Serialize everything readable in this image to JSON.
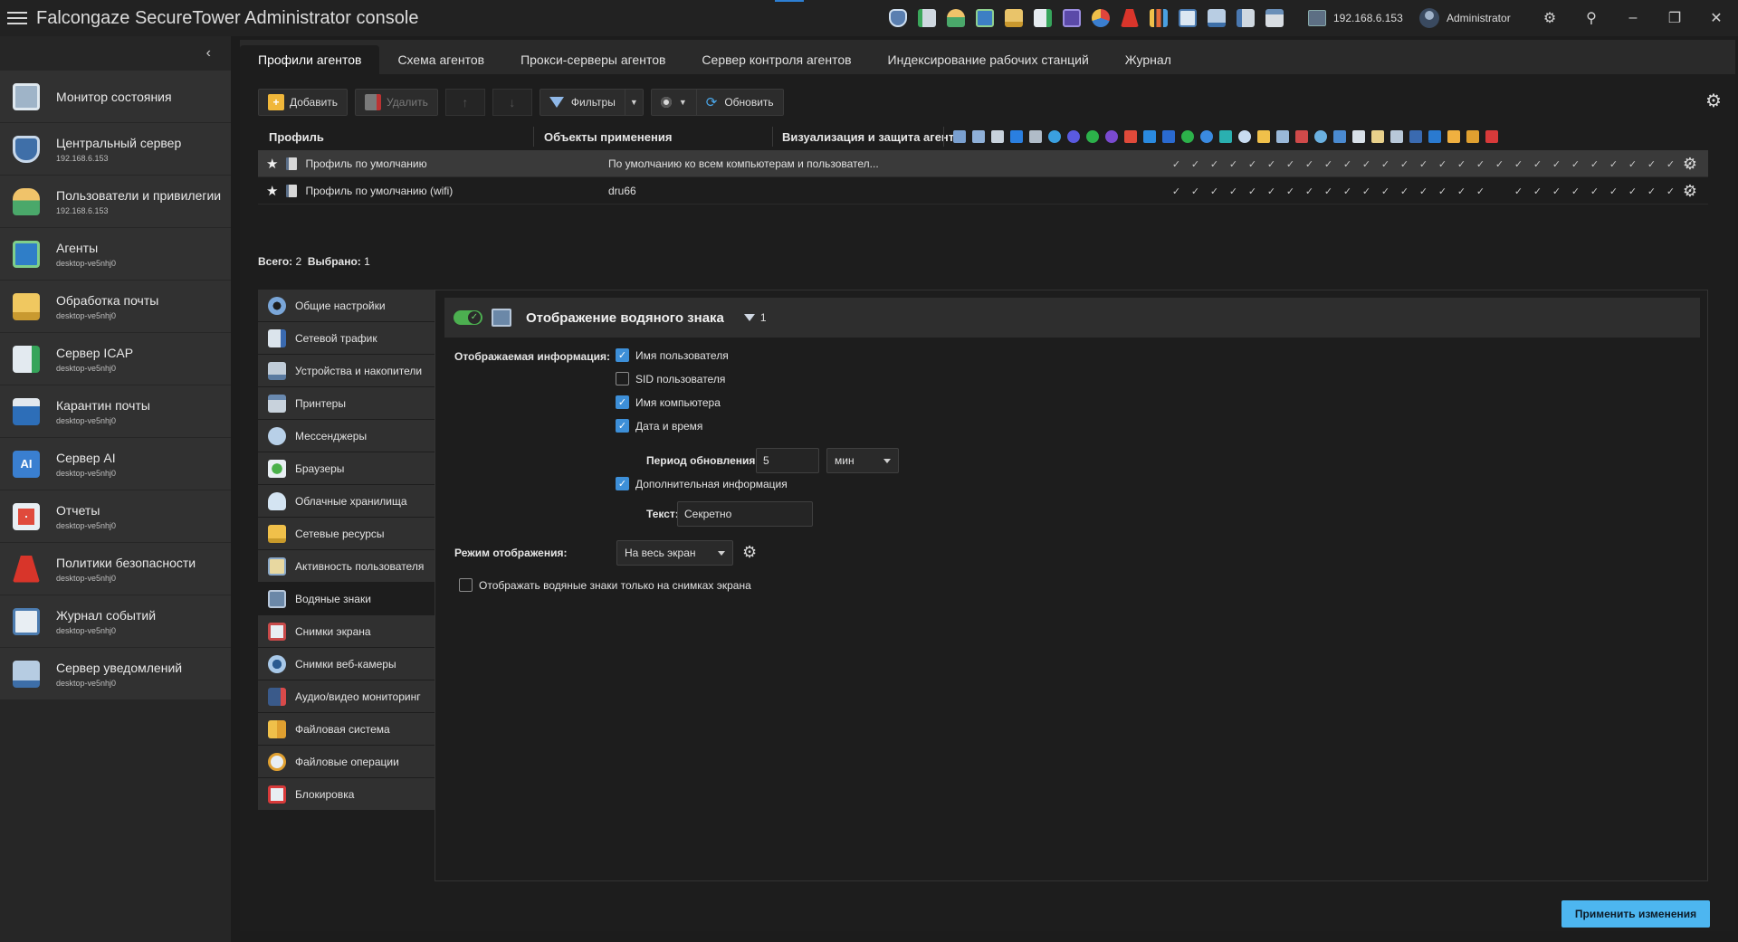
{
  "title_bar": {
    "app_name": "Falcongaze SecureTower",
    "app_subtitle": "Administrator console",
    "server_ip": "192.168.6.153",
    "user": "Administrator",
    "tray_icons": [
      "shield-icon",
      "server-icon",
      "users-icon",
      "agents-icon",
      "mail-icon",
      "icap-icon",
      "quarantine-icon",
      "reports-icon",
      "policies-icon",
      "stats-icon",
      "events-icon",
      "notify-icon",
      "network-icon",
      "printer-icon"
    ]
  },
  "left_nav": {
    "items": [
      {
        "label": "Монитор состояния",
        "sub": ""
      },
      {
        "label": "Центральный сервер",
        "sub": "192.168.6.153"
      },
      {
        "label": "Пользователи и привилегии",
        "sub": "192.168.6.153"
      },
      {
        "label": "Агенты",
        "sub": "desktop-ve5nhj0"
      },
      {
        "label": "Обработка почты",
        "sub": "desktop-ve5nhj0"
      },
      {
        "label": "Сервер ICAP",
        "sub": "desktop-ve5nhj0"
      },
      {
        "label": "Карантин почты",
        "sub": "desktop-ve5nhj0"
      },
      {
        "label": "Сервер AI",
        "sub": "desktop-ve5nhj0"
      },
      {
        "label": "Отчеты",
        "sub": "desktop-ve5nhj0"
      },
      {
        "label": "Политики безопасности",
        "sub": "desktop-ve5nhj0"
      },
      {
        "label": "Журнал событий",
        "sub": "desktop-ve5nhj0"
      },
      {
        "label": "Сервер уведомлений",
        "sub": "desktop-ve5nhj0"
      }
    ]
  },
  "tabs": [
    {
      "label": "Профили агентов"
    },
    {
      "label": "Схема агентов"
    },
    {
      "label": "Прокси-серверы агентов"
    },
    {
      "label": "Сервер контроля агентов"
    },
    {
      "label": "Индексирование рабочих станций"
    },
    {
      "label": "Журнал"
    }
  ],
  "toolbar": {
    "add": "Добавить",
    "delete": "Удалить",
    "filters": "Фильтры",
    "refresh": "Обновить"
  },
  "table": {
    "headers": {
      "profile": "Профиль",
      "objects": "Объекты применения",
      "visual": "Визуализация и защита агента"
    },
    "rows": [
      {
        "name": "Профиль по умолчанию",
        "objects": "По умолчанию ко всем компьютерам и пользовател...",
        "checks": "✓✓✓✓✓✓✓✓✓✓✓✓✓✓✓✓✓✓✓✓✓✓✓✓✓✓✓✓"
      },
      {
        "name": "Профиль по умолчанию (wifi)",
        "objects": "dru66",
        "checks": "✓✓✓✓✓✓✓✓✓✓✓✓✓✓✓✓✓ ✓✓✓✓✓✓✓✓✓✓"
      }
    ]
  },
  "summary": {
    "total_label": "Всего:",
    "total": "2",
    "selected_label": "Выбрано:",
    "selected": "1"
  },
  "categories": [
    {
      "label": "Общие настройки"
    },
    {
      "label": "Сетевой трафик"
    },
    {
      "label": "Устройства и накопители"
    },
    {
      "label": "Принтеры"
    },
    {
      "label": "Мессенджеры"
    },
    {
      "label": "Браузеры"
    },
    {
      "label": "Облачные хранилища"
    },
    {
      "label": "Сетевые ресурсы"
    },
    {
      "label": "Активность пользователя"
    },
    {
      "label": "Водяные знаки"
    },
    {
      "label": "Снимки экрана"
    },
    {
      "label": "Снимки веб-камеры"
    },
    {
      "label": "Аудио/видео мониторинг"
    },
    {
      "label": "Файловая система"
    },
    {
      "label": "Файловые операции"
    },
    {
      "label": "Блокировка"
    }
  ],
  "watermark": {
    "enabled": true,
    "title": "Отображение водяного знака",
    "filter_count": "1",
    "info_label": "Отображаемая информация:",
    "opt_username": "Имя пользователя",
    "opt_sid": "SID пользователя",
    "opt_computer": "Имя компьютера",
    "opt_datetime": "Дата и время",
    "period_label": "Период обновления:",
    "period_value": "5",
    "period_unit": "мин",
    "opt_extra": "Дополнительная информация",
    "text_label": "Текст:",
    "text_value": "Секретно",
    "mode_label": "Режим отображения:",
    "mode_value": "На весь экран",
    "only_screens": "Отображать водяные знаки только на снимках экрана"
  },
  "apply_button": "Применить изменения",
  "colors": {
    "accent": "#4db6f0",
    "toggle_on": "#4caf50",
    "checkbox_on": "#3d8fd8"
  }
}
